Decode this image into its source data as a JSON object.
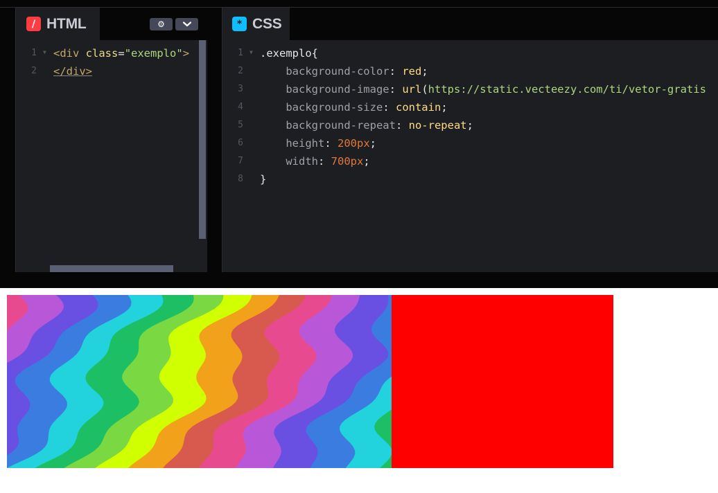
{
  "html_panel": {
    "title": "HTML",
    "icon": "slash-icon",
    "icon_glyph": "/",
    "icon_color": "#ff3c41",
    "settings_glyph": "⚙",
    "collapse_glyph": "⌄",
    "lines": [
      {
        "number": "1",
        "tokens": [
          {
            "t": "<div ",
            "c": "t-tag"
          },
          {
            "t": "class",
            "c": "t-attr"
          },
          {
            "t": "=",
            "c": "t-punct"
          },
          {
            "t": "\"exemplo\"",
            "c": "t-str"
          },
          {
            "t": ">",
            "c": "t-tag"
          }
        ]
      },
      {
        "number": "2",
        "tokens": [
          {
            "t": "</div>",
            "c": "t-close-tag"
          }
        ]
      }
    ]
  },
  "css_panel": {
    "title": "CSS",
    "icon": "asterisk-icon",
    "icon_glyph": "*",
    "icon_color": "#0ebeff",
    "lines": [
      {
        "number": "1",
        "tokens": [
          {
            "t": ".exemplo",
            "c": "t-sel"
          },
          {
            "t": "{",
            "c": "t-punct"
          }
        ]
      },
      {
        "number": "2",
        "tokens": [
          {
            "t": "    background-color",
            "c": "t-prop"
          },
          {
            "t": ": ",
            "c": "t-punct"
          },
          {
            "t": "red",
            "c": "t-val"
          },
          {
            "t": ";",
            "c": "t-punct"
          }
        ]
      },
      {
        "number": "3",
        "tokens": [
          {
            "t": "    background-image",
            "c": "t-prop"
          },
          {
            "t": ": ",
            "c": "t-punct"
          },
          {
            "t": "url",
            "c": "t-val"
          },
          {
            "t": "(",
            "c": "t-punct"
          },
          {
            "t": "https://static.vecteezy.com/ti/vetor-gratis",
            "c": "t-url"
          }
        ]
      },
      {
        "number": "4",
        "tokens": [
          {
            "t": "    background-size",
            "c": "t-prop"
          },
          {
            "t": ": ",
            "c": "t-punct"
          },
          {
            "t": "contain",
            "c": "t-val"
          },
          {
            "t": ";",
            "c": "t-punct"
          }
        ]
      },
      {
        "number": "5",
        "tokens": [
          {
            "t": "    background-repeat",
            "c": "t-prop"
          },
          {
            "t": ": ",
            "c": "t-punct"
          },
          {
            "t": "no-repeat",
            "c": "t-val"
          },
          {
            "t": ";",
            "c": "t-punct"
          }
        ]
      },
      {
        "number": "6",
        "tokens": [
          {
            "t": "    height",
            "c": "t-prop"
          },
          {
            "t": ": ",
            "c": "t-punct"
          },
          {
            "t": "200px",
            "c": "t-num"
          },
          {
            "t": ";",
            "c": "t-punct"
          }
        ]
      },
      {
        "number": "7",
        "tokens": [
          {
            "t": "    width",
            "c": "t-prop"
          },
          {
            "t": ": ",
            "c": "t-punct"
          },
          {
            "t": "700px",
            "c": "t-num"
          },
          {
            "t": ";",
            "c": "t-punct"
          }
        ]
      },
      {
        "number": "8",
        "tokens": [
          {
            "t": "}",
            "c": "t-sel"
          }
        ]
      }
    ]
  },
  "result": {
    "background_color": "#ff0000",
    "rainbow_colors": [
      "#e84a8f",
      "#b957d9",
      "#6a4fe3",
      "#3a7ce0",
      "#22d2dd",
      "#1dbf64",
      "#7ad843",
      "#cfff00",
      "#f2a21a",
      "#d85a4e",
      "#e84a8f",
      "#b957d9",
      "#6a4fe3",
      "#3a7ce0",
      "#22d2dd",
      "#1dbf64"
    ]
  }
}
